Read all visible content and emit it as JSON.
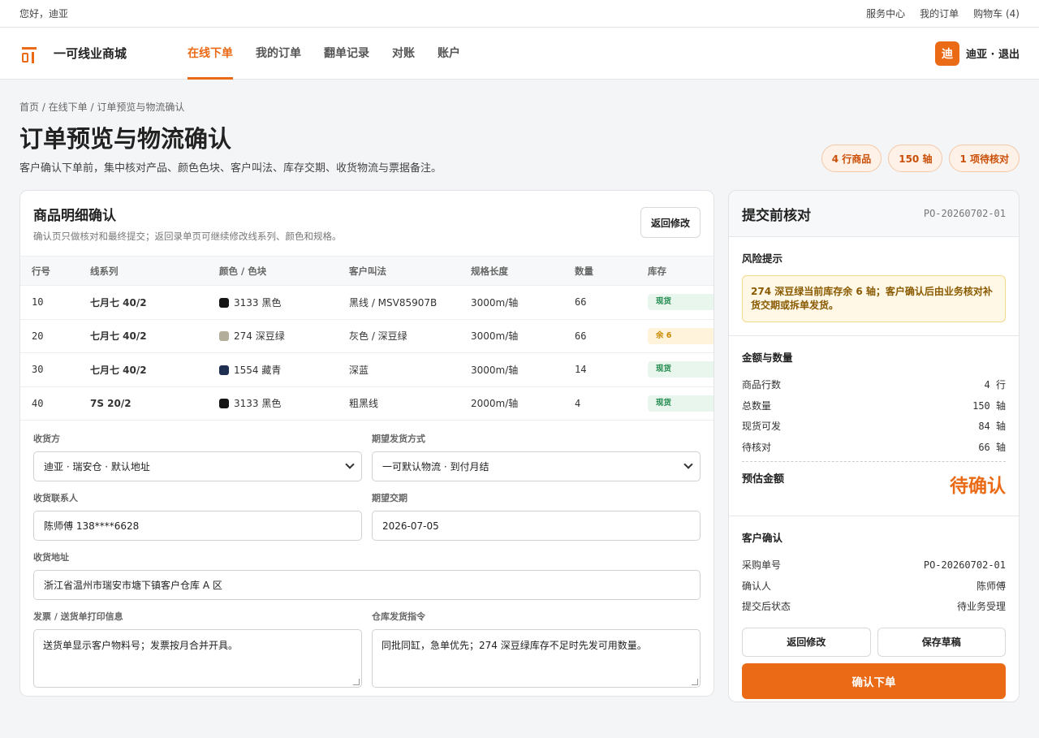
{
  "topbar": {
    "greeting": "您好，迪亚",
    "links": [
      "服务中心",
      "我的订单",
      "购物车 (4)"
    ]
  },
  "header": {
    "brand": "一可线业商城",
    "nav": [
      "在线下单",
      "我的订单",
      "翻单记录",
      "对账",
      "账户"
    ],
    "avatar_text": "迪",
    "user_label": "迪亚 · 退出"
  },
  "breadcrumb": "首页 / 在线下单 / 订单预览与物流确认",
  "page": {
    "title": "订单预览与物流确认",
    "subtitle": "客户确认下单前，集中核对产品、颜色色块、客户叫法、库存交期、收货物流与票据备注。",
    "pills": [
      "4 行商品",
      "150 轴",
      "1 项待核对"
    ]
  },
  "items_card": {
    "title": "商品明细确认",
    "desc": "确认页只做核对和最终提交；返回录单页可继续修改线系列、颜色和规格。",
    "back_label": "返回修改",
    "columns": [
      "行号",
      "线系列",
      "颜色 / 色块",
      "客户叫法",
      "规格长度",
      "数量",
      "库存"
    ],
    "rows": [
      {
        "line": "10",
        "series": "七月七 40/2",
        "color": "3133 黑色",
        "swatch": "#151515",
        "alias": "黑线 / MSV85907B",
        "spec": "3000m/轴",
        "qty": "66",
        "stock": "现货",
        "stock_type": "ok"
      },
      {
        "line": "20",
        "series": "七月七 40/2",
        "color": "274 深豆绿",
        "swatch": "#b3ad9c",
        "alias": "灰色 / 深豆绿",
        "spec": "3000m/轴",
        "qty": "66",
        "stock": "余 6",
        "stock_type": "low"
      },
      {
        "line": "30",
        "series": "七月七 40/2",
        "color": "1554 藏青",
        "swatch": "#1f2f52",
        "alias": "深蓝",
        "spec": "3000m/轴",
        "qty": "14",
        "stock": "现货",
        "stock_type": "ok"
      },
      {
        "line": "40",
        "series": "7S 20/2",
        "color": "3133 黑色",
        "swatch": "#151515",
        "alias": "粗黑线",
        "spec": "2000m/轴",
        "qty": "4",
        "stock": "现货",
        "stock_type": "ok"
      }
    ]
  },
  "form": {
    "receiver_label": "收货方",
    "receiver_value": "迪亚 · 瑞安仓 · 默认地址",
    "ship_label": "期望发货方式",
    "ship_value": "一可默认物流 · 到付月结",
    "contact_label": "收货联系人",
    "contact_value": "陈师傅 138****6628",
    "date_label": "期望交期",
    "date_value": "2026-07-05",
    "address_label": "收货地址",
    "address_value": "浙江省温州市瑞安市塘下镇客户仓库 A 区",
    "invoice_label": "发票 / 送货单打印信息",
    "invoice_value": "送货单显示客户物料号；发票按月合并开具。",
    "warehouse_label": "仓库发货指令",
    "warehouse_value": "同批同缸，急单优先；274 深豆绿库存不足时先发可用数量。"
  },
  "summary": {
    "title": "提交前核对",
    "po": "PO-20260702-01",
    "risk_title": "风险提示",
    "risk_text": "274 深豆绿当前库存余 6 轴；客户确认后由业务核对补货交期或拆单发货。",
    "amount_title": "金额与数量",
    "rows": [
      {
        "k": "商品行数",
        "v": "4 行"
      },
      {
        "k": "总数量",
        "v": "150 轴"
      },
      {
        "k": "现货可发",
        "v": "84 轴"
      },
      {
        "k": "待核对",
        "v": "66 轴"
      }
    ],
    "estimate_label": "预估金额",
    "estimate_value": "待确认",
    "confirm_title": "客户确认",
    "confirm_rows": [
      {
        "k": "采购单号",
        "v": "PO-20260702-01"
      },
      {
        "k": "确认人",
        "v": "陈师傅"
      },
      {
        "k": "提交后状态",
        "v": "待业务受理"
      }
    ],
    "back_label": "返回修改",
    "draft_label": "保存草稿",
    "submit_label": "确认下单"
  },
  "colors": {
    "accent": "#ea6a16",
    "ok_bg": "#e8f6ee",
    "ok_fg": "#1f8a4c",
    "low_bg": "#fff3dc",
    "low_fg": "#c98a00"
  }
}
